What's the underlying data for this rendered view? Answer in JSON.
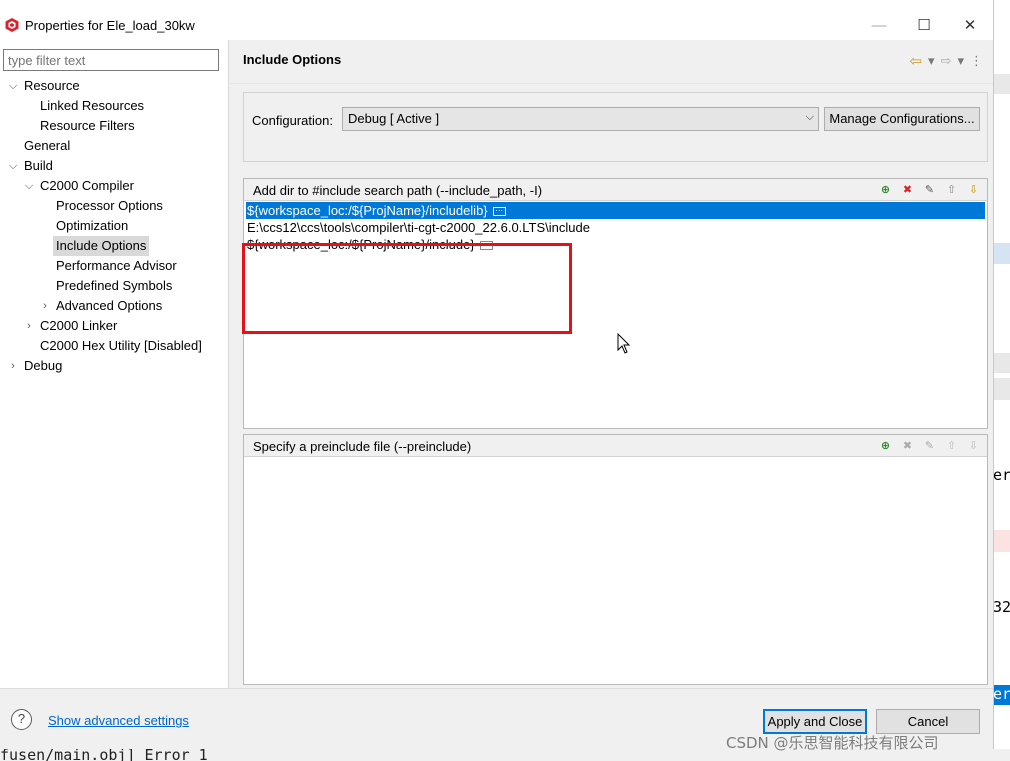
{
  "window": {
    "title": "Properties for Ele_load_30kw",
    "minimize_glyph": "—",
    "maximize_glyph": "☐",
    "close_glyph": "✕"
  },
  "sidebar": {
    "filter_placeholder": "type filter text",
    "items": [
      {
        "label": "Resource",
        "expanded": true
      },
      {
        "label": "Linked Resources"
      },
      {
        "label": "Resource Filters"
      },
      {
        "label": "General"
      },
      {
        "label": "Build",
        "expanded": true
      },
      {
        "label": "C2000 Compiler",
        "expanded": true
      },
      {
        "label": "Processor Options"
      },
      {
        "label": "Optimization"
      },
      {
        "label": "Include Options",
        "selected": true
      },
      {
        "label": "Performance Advisor"
      },
      {
        "label": "Predefined Symbols"
      },
      {
        "label": "Advanced Options",
        "expanded": false
      },
      {
        "label": "C2000 Linker",
        "expanded": false
      },
      {
        "label": "C2000 Hex Utility  [Disabled]"
      },
      {
        "label": "Debug",
        "expanded": false
      }
    ]
  },
  "main": {
    "title": "Include Options",
    "configuration": {
      "label": "Configuration:",
      "selected": "Debug  [ Active ]",
      "manage_button": "Manage Configurations..."
    },
    "include_paths": {
      "header": "Add dir to #include search path (--include_path, -I)",
      "rows": [
        "${workspace_loc:/${ProjName}/includelib}",
        "E:\\ccs12\\ccs\\tools\\compiler\\ti-cgt-c2000_22.6.0.LTS\\include",
        "${workspace_loc:/${ProjName}/include}"
      ],
      "selected_index": 0
    },
    "preinclude": {
      "header": "Specify a preinclude file (--preinclude)",
      "rows": []
    }
  },
  "footer": {
    "help_glyph": "?",
    "advanced_link": "Show advanced settings",
    "apply_button": "Apply and Close",
    "cancel_button": "Cancel"
  },
  "background": {
    "bottom_text": "fusen/main.obj] Error 1",
    "right_fragments": [
      "er",
      "32",
      "er"
    ]
  },
  "watermark": "CSDN @乐思智能科技有限公司",
  "colors": {
    "selection": "#0078d7",
    "annotation": "#e80f17",
    "link": "#0066cc"
  }
}
